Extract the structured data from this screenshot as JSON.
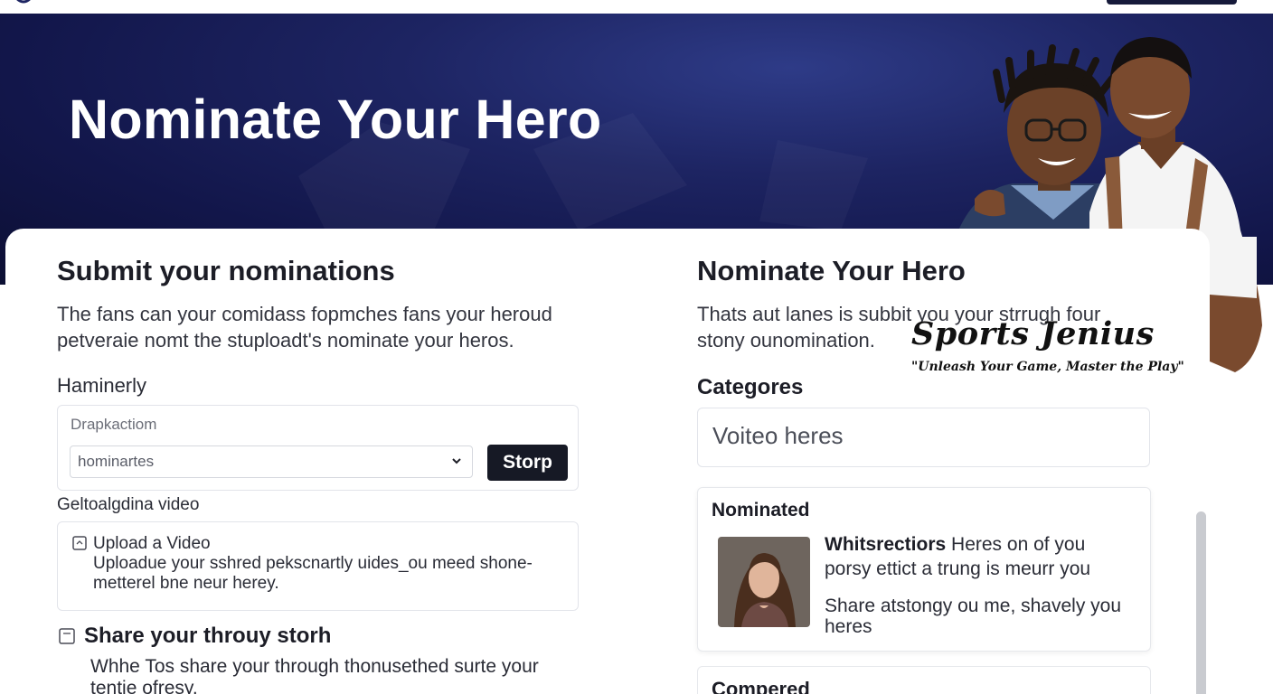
{
  "hero": {
    "title": "Nominate Your Hero"
  },
  "left": {
    "heading": "Submit your nominations",
    "intro_line1": "The fans can your comidass fopmches fans your heroud",
    "intro_line2": "petveraie nomt the stuploadt's nominate your heros.",
    "field_label": "Haminerly",
    "field_placeholder": "Drapkactiom",
    "select_value": "hominartes",
    "submit_button": "Storp",
    "video_label": "Geltoalgdina video",
    "upload_title": "Upload a Video",
    "upload_desc_line1": "Uploadue your sshred pekscnartly uides_ou meed shone-",
    "upload_desc_line2": "metterel bne neur herey.",
    "share_heading": "Share your throuy storh",
    "share_desc_line1": "Whhe Tos share your through thonusethed surte your",
    "share_desc_line2": "tentie ofresy."
  },
  "right": {
    "heading": "Nominate Your Hero",
    "intro_line1": "Thats aut lanes is subbit you your strrugh four",
    "intro_line2": "stony ounomination.",
    "categories_label": "Categores",
    "categories_placeholder": "Voiteo heres",
    "nominated_label": "Nominated",
    "nominee_name": "Whitsrectiors",
    "nominee_line1_rest": " Heres on of you",
    "nominee_line2": "porsy ettict a trung is meurr you",
    "nominee_line3": "Share atstongy ou me, shavely you",
    "nominee_line4": "heres",
    "next_card_label": "Compered"
  },
  "brand": {
    "name": "Sports Jenius",
    "tagline": "\"Unleash Your Game, Master the Play\""
  },
  "icons": {
    "chevron": "chevron-down-icon",
    "upload": "upload-icon",
    "share": "share-icon"
  },
  "colors": {
    "hero_bg": "#12164a",
    "button_dark": "#161925",
    "text_primary": "#1c1d26"
  }
}
